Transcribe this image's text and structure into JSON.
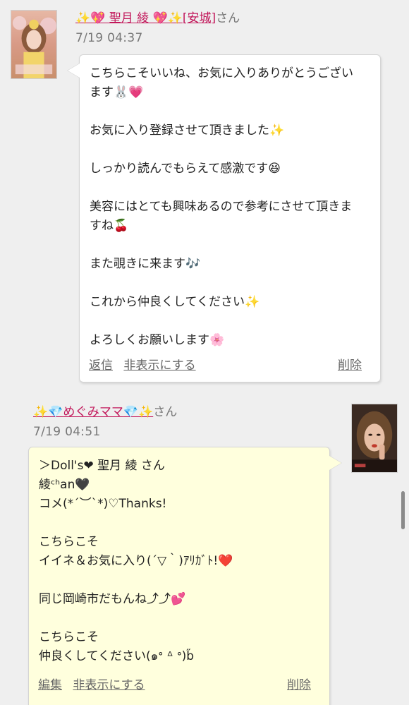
{
  "comments": [
    {
      "name_prefix": "✨💖 ",
      "name": "聖月 綾",
      "name_suffix": " 💖✨",
      "area": "[安城]",
      "honorific": "さん",
      "date": "7/19 04:37",
      "lines": [
        "こちらこそいいね、お気に入りありがとうござい",
        "ます🐰💗",
        "",
        "お気に入り登録させて頂きました✨",
        "",
        "しっかり読んでもらえて感激です😆",
        "",
        "美容にはとても興味あるので参考にさせて頂きま",
        "すね🍒",
        "",
        "また覗きに来ます🎶",
        "",
        "これから仲良くしてください✨",
        "",
        "よろしくお願いします🌸"
      ],
      "actions": {
        "reply": "返信",
        "hide": "非表示にする",
        "delete": "削除"
      }
    },
    {
      "name_prefix": "✨💎",
      "name": "めぐみママ",
      "name_suffix": "💎✨",
      "honorific": "さん",
      "date": "7/19 04:51",
      "lines": [
        "＞Doll's❤ 聖月 綾 さん",
        "綾ᶜʰan🖤",
        "コメ(*´︶`*)♡Thanks!",
        "",
        "こちらこそ",
        "イイネ＆お気に入り(´▽｀)ｱﾘｶﾞﾄ!❤️",
        "",
        "同じ岡崎市だもんね⤴︎⤴︎💕",
        "",
        "こちらこそ",
        "仲良くしてください(๑ᐤ ᐞ ᐤ)b̋"
      ],
      "actions": {
        "edit": "編集",
        "hide": "非表示にする",
        "delete": "削除"
      }
    }
  ]
}
